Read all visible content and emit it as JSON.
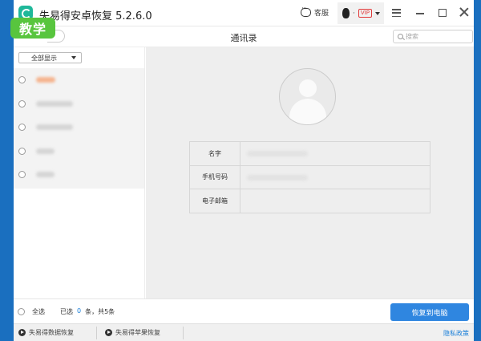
{
  "app": {
    "title": "失易得安卓恢复  5.2.6.0",
    "support_label": "客服",
    "user_separator": "·",
    "vip_label": "VIP"
  },
  "overlay": {
    "teach_label": "教学"
  },
  "toolbar": {
    "page_title": "通讯录",
    "search_placeholder": "搜索"
  },
  "sidebar": {
    "filter_label": "全部显示",
    "contacts": [
      {
        "name_color": "#f5b48f",
        "name_width": 0.15
      },
      {
        "name_color": "#d5d5d5",
        "name_width": 0.28
      },
      {
        "name_color": "#d5d5d5",
        "name_width": 0.28
      },
      {
        "name_color": "#d5d5d5",
        "name_width": 0.14
      },
      {
        "name_color": "#d5d5d5",
        "name_width": 0.14
      }
    ]
  },
  "detail": {
    "fields": [
      {
        "label": "名字"
      },
      {
        "label": "手机号码"
      },
      {
        "label": "电子邮箱"
      }
    ]
  },
  "bottom": {
    "select_all_label": "全选",
    "selected_prefix": "已选",
    "selected_count": "0",
    "selected_suffix": "条，共5条",
    "recover_button": "恢复到电脑"
  },
  "footer": {
    "link1": "失易得数据恢复",
    "link2": "失易得苹果恢复",
    "privacy": "隐私政策"
  },
  "colors": {
    "accent": "#2f86e0",
    "brand": "#1fb89a",
    "teach": "#58c53e",
    "frame": "#1a6fbf"
  }
}
